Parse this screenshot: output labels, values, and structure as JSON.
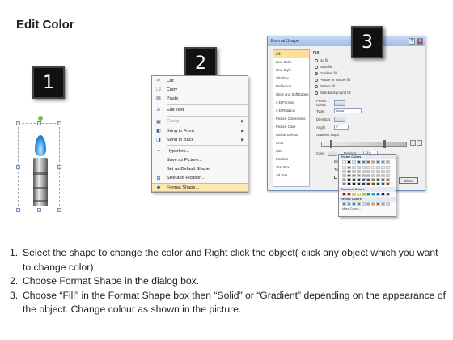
{
  "title": "Edit Color",
  "steps": [
    {
      "num": "1",
      "text": "Select the shape to change the color and Right click the object( click any object which you want to change color)"
    },
    {
      "num": "2",
      "text": "Choose Format Shape in the dialog box."
    },
    {
      "num": "3",
      "text": "Choose “Fill” in the Format Shape box then “Solid” or “Gradient” depending on the appearance of the object. Change colour as shown in the picture."
    }
  ],
  "badges": [
    "1",
    "2",
    "3"
  ],
  "context_menu": {
    "items": [
      {
        "label": "Cut",
        "icon": "scissors-icon",
        "glyph": "✂",
        "disabled": false,
        "submenu": false
      },
      {
        "label": "Copy",
        "icon": "copy-icon",
        "glyph": "❐",
        "disabled": false,
        "submenu": false
      },
      {
        "label": "Paste",
        "icon": "paste-icon",
        "glyph": "▤",
        "disabled": false,
        "submenu": false
      },
      {
        "sep": true
      },
      {
        "label": "Edit Text",
        "icon": "edit-text-icon",
        "glyph": "A",
        "disabled": false,
        "submenu": false
      },
      {
        "sep": true
      },
      {
        "label": "Group",
        "icon": "group-icon",
        "glyph": "▣",
        "disabled": true,
        "submenu": true
      },
      {
        "label": "Bring to Front",
        "icon": "bring-front-icon",
        "glyph": "◧",
        "disabled": false,
        "submenu": true
      },
      {
        "label": "Send to Back",
        "icon": "send-back-icon",
        "glyph": "◨",
        "disabled": false,
        "submenu": true
      },
      {
        "sep": true
      },
      {
        "label": "Hyperlink...",
        "icon": "hyperlink-icon",
        "glyph": "⚭",
        "disabled": false,
        "submenu": false
      },
      {
        "label": "Save as Picture...",
        "icon": "",
        "glyph": "",
        "disabled": false,
        "submenu": false
      },
      {
        "label": "Set as Default Shape",
        "icon": "",
        "glyph": "",
        "disabled": false,
        "submenu": false
      },
      {
        "label": "Size and Position...",
        "icon": "size-icon",
        "glyph": "⊞",
        "disabled": false,
        "submenu": false
      },
      {
        "label": "Format Shape...",
        "icon": "format-shape-icon",
        "glyph": "◆",
        "disabled": false,
        "submenu": false,
        "highlight": true
      }
    ]
  },
  "dialog": {
    "title": "Format Shape",
    "help": "?",
    "close": "X",
    "categories": [
      "Fill",
      "Line Color",
      "Line Style",
      "Shadow",
      "Reflection",
      "Glow and Soft Edges",
      "3-D Format",
      "3-D Rotation",
      "Picture Corrections",
      "Picture Color",
      "Artistic Effects",
      "Crop",
      "Size",
      "Position",
      "Text Box",
      "Alt Text"
    ],
    "selected_category": "Fill",
    "pane_heading": "Fill",
    "fill_options": [
      {
        "label": "No fill",
        "on": false
      },
      {
        "label": "Solid fill",
        "on": false
      },
      {
        "label": "Gradient fill",
        "on": true
      },
      {
        "label": "Picture or texture fill",
        "on": false
      },
      {
        "label": "Pattern fill",
        "on": false
      },
      {
        "label": "Slide background fill",
        "on": false
      }
    ],
    "preset_label": "Preset colors:",
    "type_label": "Type:",
    "type_value": "Linear",
    "direction_label": "Direction:",
    "angle_label": "Angle:",
    "angle_value": "0°",
    "stops_label": "Gradient stops",
    "color_label": "Color",
    "position_label": "Position:",
    "position_value": "73%",
    "brightness_label": "Brightness",
    "transparency_label": "Tran",
    "rotate_label": "Rotate",
    "close_label": "Close"
  },
  "color_dropdown": {
    "theme_label": "Theme Colors",
    "standard_label": "Standard Colors",
    "recent_label": "Recent Colors",
    "more_label": "More Colors...",
    "theme_top": [
      "#ffffff",
      "#000000",
      "#eeece1",
      "#1f497d",
      "#4f81bd",
      "#c0504d",
      "#9bbb59",
      "#8064a2",
      "#4bacc6",
      "#f79646"
    ],
    "theme_shades": [
      [
        "#f2f2f2",
        "#7f7f7f",
        "#ddd9c3",
        "#c6d9f0",
        "#dbe5f1",
        "#f2dcdb",
        "#ebf1dd",
        "#e5e0ec",
        "#dbeef3",
        "#fdeada"
      ],
      [
        "#d8d8d8",
        "#595959",
        "#c4bd97",
        "#8db3e2",
        "#b8cce4",
        "#e5b9b7",
        "#d7e3bc",
        "#ccc1d9",
        "#b7dde8",
        "#fbd5b5"
      ],
      [
        "#bfbfbf",
        "#3f3f3f",
        "#938953",
        "#548dd4",
        "#95b3d7",
        "#d99694",
        "#c3d69b",
        "#b2a2c7",
        "#92cddc",
        "#fac08f"
      ],
      [
        "#a5a5a5",
        "#262626",
        "#494429",
        "#17365d",
        "#366092",
        "#953734",
        "#76923c",
        "#5f497a",
        "#31859b",
        "#e36c09"
      ],
      [
        "#7f7f7f",
        "#0c0c0c",
        "#1d1b10",
        "#0f243e",
        "#244061",
        "#632423",
        "#4f6128",
        "#3f3151",
        "#205867",
        "#974806"
      ]
    ],
    "standard": [
      "#c00000",
      "#ff0000",
      "#ffc000",
      "#ffff00",
      "#92d050",
      "#00b050",
      "#00b0f0",
      "#0070c0",
      "#002060",
      "#7030a0"
    ],
    "recent": [
      "#4f81bd",
      "#5fa8dd",
      "#2a8ee0",
      "#7f7f7f",
      "#c6d9f0",
      "#9bbb59",
      "#f79646",
      "#8064a2",
      "#d99694",
      "#b7dde8"
    ]
  }
}
